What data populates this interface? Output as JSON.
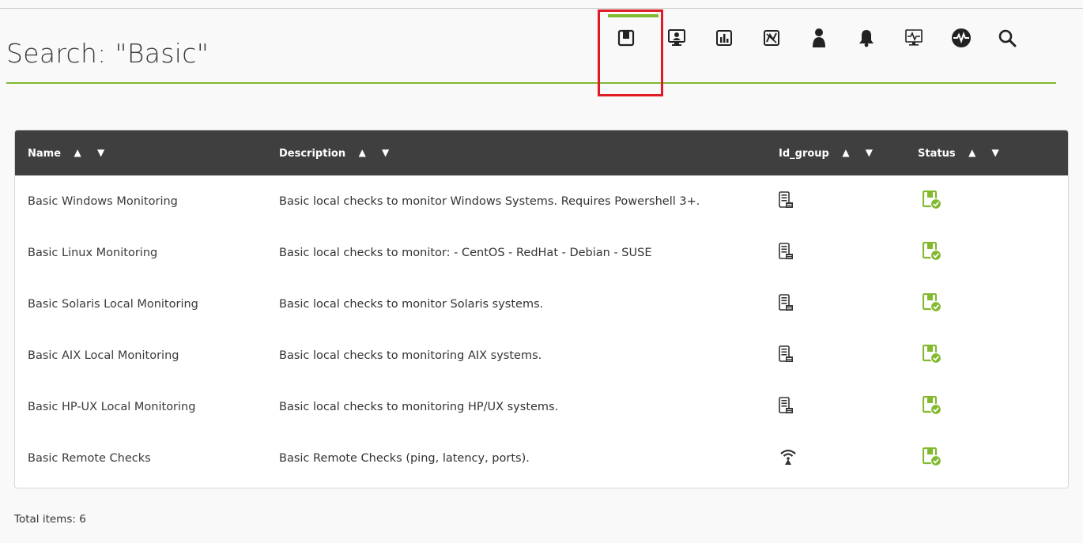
{
  "header": {
    "title": "Search: \"Basic\""
  },
  "toolbar": {
    "items": [
      {
        "name": "module-templates-icon",
        "active": true
      },
      {
        "name": "agents-icon"
      },
      {
        "name": "reports-icon"
      },
      {
        "name": "graphs-icon"
      },
      {
        "name": "users-icon"
      },
      {
        "name": "alerts-icon"
      },
      {
        "name": "monitors-icon"
      },
      {
        "name": "services-icon"
      },
      {
        "name": "search-icon"
      }
    ],
    "accent_color": "#82b92e",
    "highlight_color": "#e01b24"
  },
  "table": {
    "columns": {
      "name": "Name",
      "description": "Description",
      "id_group": "Id_group",
      "status": "Status"
    },
    "sort_glyph": "▲ ▼",
    "rows": [
      {
        "name": "Basic Windows Monitoring",
        "description": "Basic local checks to monitor Windows Systems. Requires Powershell 3+.",
        "group_icon": "server-icon",
        "status_icon": "status-ok-icon"
      },
      {
        "name": "Basic Linux Monitoring",
        "description": "Basic local checks to monitor: - CentOS - RedHat - Debian - SUSE",
        "group_icon": "server-icon",
        "status_icon": "status-ok-icon"
      },
      {
        "name": "Basic Solaris Local Monitoring",
        "description": "Basic local checks to monitor Solaris systems.",
        "group_icon": "server-icon",
        "status_icon": "status-ok-icon"
      },
      {
        "name": "Basic AIX Local Monitoring",
        "description": "Basic local checks to monitoring AIX systems.",
        "group_icon": "server-icon",
        "status_icon": "status-ok-icon"
      },
      {
        "name": "Basic HP-UX Local Monitoring",
        "description": "Basic local checks to monitoring HP/UX systems.",
        "group_icon": "server-icon",
        "status_icon": "status-ok-icon"
      },
      {
        "name": "Basic Remote Checks",
        "description": "Basic Remote Checks (ping, latency, ports).",
        "group_icon": "antenna-icon",
        "status_icon": "status-ok-icon"
      }
    ]
  },
  "footer": {
    "total": "Total items: 6"
  }
}
